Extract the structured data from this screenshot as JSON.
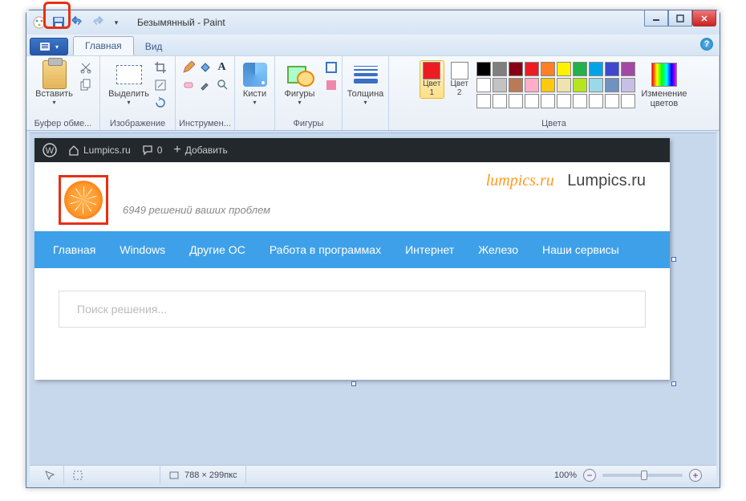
{
  "window": {
    "title": "Безымянный - Paint"
  },
  "qat": {
    "paint_icon": "paint-icon",
    "save_icon": "save-icon",
    "undo_icon": "undo-icon",
    "redo_icon": "redo-icon"
  },
  "tabs": {
    "home": "Главная",
    "view": "Вид"
  },
  "ribbon": {
    "clipboard": {
      "paste": "Вставить",
      "group": "Буфер обме..."
    },
    "image": {
      "select": "Выделить",
      "group": "Изображение"
    },
    "tools": {
      "group": "Инструмен..."
    },
    "brushes": {
      "label": "Кисти"
    },
    "shapes": {
      "label": "Фигуры",
      "group": "Фигуры"
    },
    "size": {
      "label": "Толщина"
    },
    "colors": {
      "color1": "Цвет\n1",
      "color2": "Цвет\n2",
      "edit": "Изменение\nцветов",
      "group": "Цвета",
      "color1_hex": "#ed1c24",
      "color2_hex": "#ffffff",
      "palette_row1": [
        "#000000",
        "#7f7f7f",
        "#880015",
        "#ed1c24",
        "#ff7f27",
        "#fff200",
        "#22b14c",
        "#00a2e8",
        "#3f48cc",
        "#a349a4"
      ],
      "palette_row2": [
        "#ffffff",
        "#c3c3c3",
        "#b97a57",
        "#ffaec9",
        "#ffc90e",
        "#efe4b0",
        "#b5e61d",
        "#99d9ea",
        "#7092be",
        "#c8bfe7"
      ],
      "palette_row3": [
        "#ffffff",
        "#ffffff",
        "#ffffff",
        "#ffffff",
        "#ffffff",
        "#ffffff",
        "#ffffff",
        "#ffffff",
        "#ffffff",
        "#ffffff"
      ]
    }
  },
  "canvas_content": {
    "wp_admin": {
      "site": "Lumpics.ru",
      "comments": "0",
      "add": "Добавить"
    },
    "header": {
      "tagline": "6949 решений ваших проблем",
      "title_orange": "lumpics.ru",
      "title_dark": "Lumpics.ru"
    },
    "nav": [
      "Главная",
      "Windows",
      "Другие ОС",
      "Работа в программах",
      "Интернет",
      "Железо",
      "Наши сервисы"
    ],
    "search_placeholder": "Поиск решения..."
  },
  "status": {
    "dimensions": "788 × 299пкс",
    "zoom": "100%"
  }
}
